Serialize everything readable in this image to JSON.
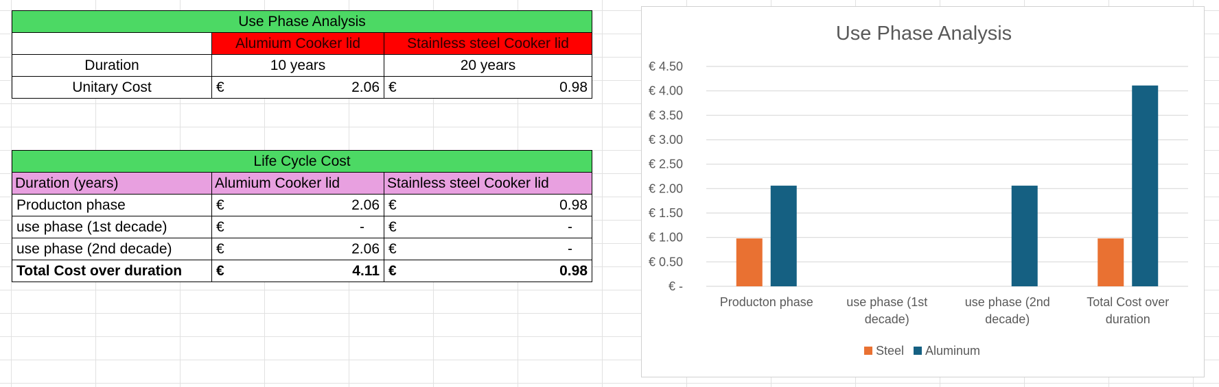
{
  "table1": {
    "title": "Use Phase Analysis",
    "col_aluminium": "Alumium Cooker lid",
    "col_steel": "Stainless steel Cooker lid",
    "rows": [
      {
        "label": "Duration",
        "alu": "10 years",
        "steel": "20 years"
      },
      {
        "label": "Unitary Cost",
        "alu_sym": "€",
        "alu": "2.06",
        "steel_sym": "€",
        "steel": "0.98"
      }
    ]
  },
  "table2": {
    "title": "Life Cycle Cost",
    "headers": [
      "Duration (years)",
      "Alumium Cooker lid",
      "Stainless steel Cooker lid"
    ],
    "rows": [
      {
        "label": "Producton phase",
        "alu_sym": "€",
        "alu": "2.06",
        "steel_sym": "€",
        "steel": "0.98"
      },
      {
        "label": "use phase (1st decade)",
        "alu_sym": "€",
        "alu": "-",
        "steel_sym": "€",
        "steel": "-"
      },
      {
        "label": "use phase (2nd decade)",
        "alu_sym": "€",
        "alu": "2.06",
        "steel_sym": "€",
        "steel": "-"
      },
      {
        "label": "Total Cost over duration",
        "alu_sym": "€",
        "alu": "4.11",
        "steel_sym": "€",
        "steel": "0.98"
      }
    ]
  },
  "colors": {
    "header_green": "#4cd964",
    "header_red": "#ff0000",
    "header_pink": "#e8a0e0",
    "steel": "#e97132",
    "aluminum": "#156082"
  },
  "chart_data": {
    "type": "bar",
    "title": "Use Phase Analysis",
    "categories": [
      [
        "Producton phase"
      ],
      [
        "use phase (1st",
        "decade)"
      ],
      [
        "use phase (2nd",
        "decade)"
      ],
      [
        "Total Cost over",
        "duration"
      ]
    ],
    "series": [
      {
        "name": "Steel",
        "values": [
          0.98,
          0,
          0,
          0.98
        ]
      },
      {
        "name": "Aluminum",
        "values": [
          2.06,
          0,
          2.06,
          4.11
        ]
      }
    ],
    "ylim": [
      0,
      4.5
    ],
    "yticks": [
      "€ -",
      "€ 0.50",
      "€ 1.00",
      "€ 1.50",
      "€ 2.00",
      "€ 2.50",
      "€ 3.00",
      "€ 3.50",
      "€ 4.00",
      "€ 4.50"
    ],
    "grid": true,
    "legend": "bottom"
  }
}
